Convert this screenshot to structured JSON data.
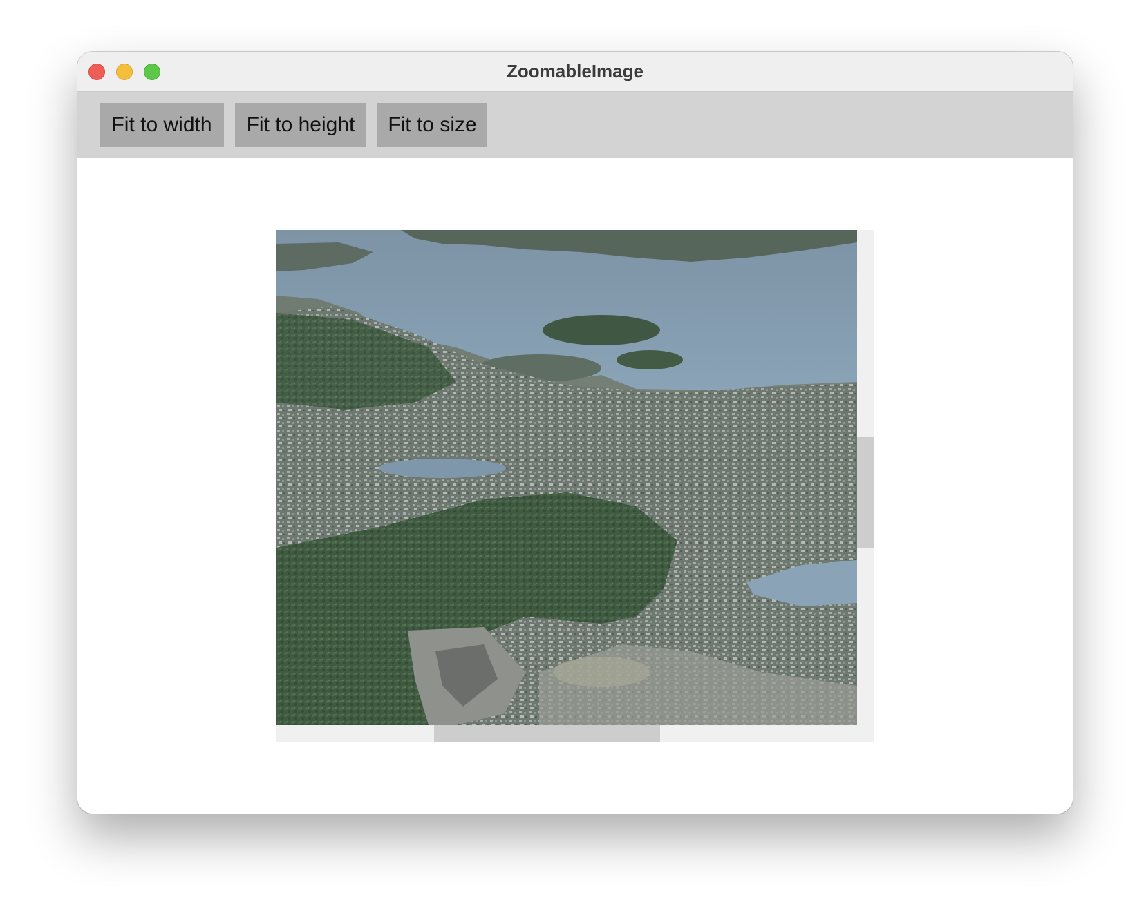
{
  "window": {
    "title": "ZoomableImage",
    "controls": [
      "close",
      "minimize",
      "zoom"
    ]
  },
  "toolbar": {
    "buttons": [
      {
        "label": "Fit to width"
      },
      {
        "label": "Fit to height"
      },
      {
        "label": "Fit to size"
      }
    ]
  },
  "viewer": {
    "image_description_icon": "aerial-photo-image",
    "colors": {
      "button_bg": "#a9a9a9",
      "toolbar_bg": "#d3d3d3",
      "scroll_track": "#f0f0f0",
      "scroll_thumb": "#cdcdcd"
    }
  }
}
